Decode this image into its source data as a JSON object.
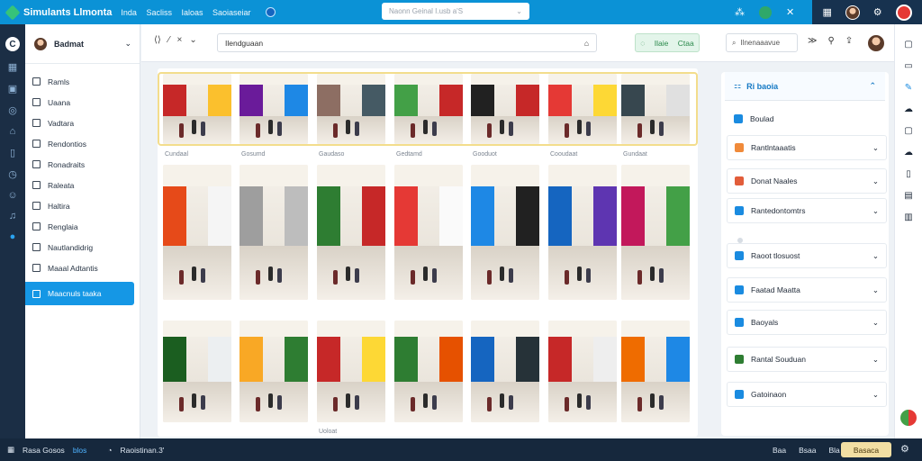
{
  "topbar": {
    "title": "Simulants Llmonta",
    "menu": [
      "Inda",
      "Sacliss",
      "Ialoas",
      "Saoiaseiar"
    ],
    "search_placeholder": "Naonn Geinal I.usb a'S",
    "icons": [
      "pen-icon",
      "wand-icon",
      "gear-badge-icon",
      "close-icon",
      "grid-icon",
      "avatar",
      "settings-icon",
      "avatar-red"
    ]
  },
  "rail": {
    "icons": [
      "app-logo-icon",
      "grid-icon",
      "chat-icon",
      "compass-icon",
      "home-icon",
      "book-icon",
      "clock-icon",
      "smile-icon",
      "bell-icon",
      "active-circle-icon"
    ]
  },
  "sidebar": {
    "user": "Badmat",
    "items": [
      {
        "label": "Ramls",
        "active": false
      },
      {
        "label": "Uaana",
        "active": false
      },
      {
        "label": "Vadtara",
        "active": false
      },
      {
        "label": "Rendontios",
        "active": false
      },
      {
        "label": "Ronadraits",
        "active": false
      },
      {
        "label": "Raleata",
        "active": false
      },
      {
        "label": "Haltira",
        "active": false
      },
      {
        "label": "Renglaia",
        "active": false
      },
      {
        "label": "Nautlandidrig",
        "active": false
      },
      {
        "label": "Maaal Adtantis",
        "active": false
      },
      {
        "label": "Maacnuls taaka",
        "active": true
      }
    ]
  },
  "main_header": {
    "tools": [
      "⟨⟩",
      "⁄",
      "×",
      "⌄"
    ],
    "input_value": "Ilendguaan",
    "green_labels": [
      "Ilaie",
      "Ctaa"
    ],
    "search2": "Ilnenaaavue",
    "icons": [
      "arrows-icon",
      "user-icon",
      "share-icon",
      "avatar"
    ]
  },
  "gallery": {
    "row1_captions": [
      "Cundaal",
      "Gosumd",
      "Gaudaso",
      "Gedtamd",
      "Gooduot",
      "Cooudaat",
      "Gundaat"
    ],
    "row2_captions": [
      "",
      "",
      "",
      "",
      "",
      "",
      ""
    ],
    "row3_captions": [
      "",
      "",
      "Uoloat",
      "",
      "",
      "",
      ""
    ],
    "stores": [
      [
        "#c62828",
        "#fbc02d"
      ],
      [
        "#6a1b9a",
        "#1e88e5"
      ],
      [
        "#8d6e63",
        "#455a64"
      ],
      [
        "#43a047",
        "#c62828"
      ],
      [
        "#212121",
        "#c62828"
      ],
      [
        "#e53935",
        "#fdd835"
      ],
      [
        "#37474f",
        "#e0e0e0"
      ],
      [
        "#e64a19",
        "#f5f5f5"
      ],
      [
        "#9e9e9e",
        "#bdbdbd"
      ],
      [
        "#2e7d32",
        "#c62828"
      ],
      [
        "#e53935",
        "#fafafa"
      ],
      [
        "#1e88e5",
        "#212121"
      ],
      [
        "#1565c0",
        "#5e35b1"
      ],
      [
        "#c2185b",
        "#43a047"
      ],
      [
        "#1b5e20",
        "#eceff1"
      ],
      [
        "#f9a825",
        "#2e7d32"
      ],
      [
        "#c62828",
        "#fdd835"
      ],
      [
        "#2e7d32",
        "#e65100"
      ],
      [
        "#1565c0",
        "#263238"
      ],
      [
        "#c62828",
        "#eeeeee"
      ],
      [
        "#ef6c00",
        "#1e88e5"
      ]
    ]
  },
  "right_panel": {
    "header": "Ri baoia",
    "rows": [
      {
        "label": "Boulad",
        "color": "#1a8be0",
        "chevron": false
      },
      {
        "label": "Rantlntaaatis",
        "color": "#f08a3a",
        "chevron": true
      },
      {
        "label": "Donat Naales",
        "color": "#e25d3a",
        "chevron": true
      },
      {
        "label": "Rantedontomtrs",
        "color": "#1a8be0",
        "chevron": true
      },
      {
        "label": "Raoot tlosuost",
        "color": "#1a8be0",
        "chevron": true
      },
      {
        "label": "Faatad Maatta",
        "color": "#1a8be0",
        "chevron": true
      },
      {
        "label": "Baoyals",
        "color": "#1a8be0",
        "chevron": true
      },
      {
        "label": "Rantal Souduan",
        "color": "#2e7d32",
        "chevron": true
      },
      {
        "label": "Gatoinaon",
        "color": "#1a8be0",
        "chevron": true
      }
    ]
  },
  "right_rail": {
    "icons": [
      "bookmark-icon",
      "tablet-icon",
      "pen-icon",
      "cloud-icon",
      "square-icon",
      "cloud-icon",
      "phone-icon",
      "book-icon",
      "sidebar-icon"
    ]
  },
  "bottombar": {
    "left_text": "Rasa Gosos",
    "left_link": "blos",
    "status_text": "Raoistinan.3'",
    "right_items": [
      "Baa",
      "Bsaa",
      "Bla"
    ],
    "button": "Basaca"
  }
}
